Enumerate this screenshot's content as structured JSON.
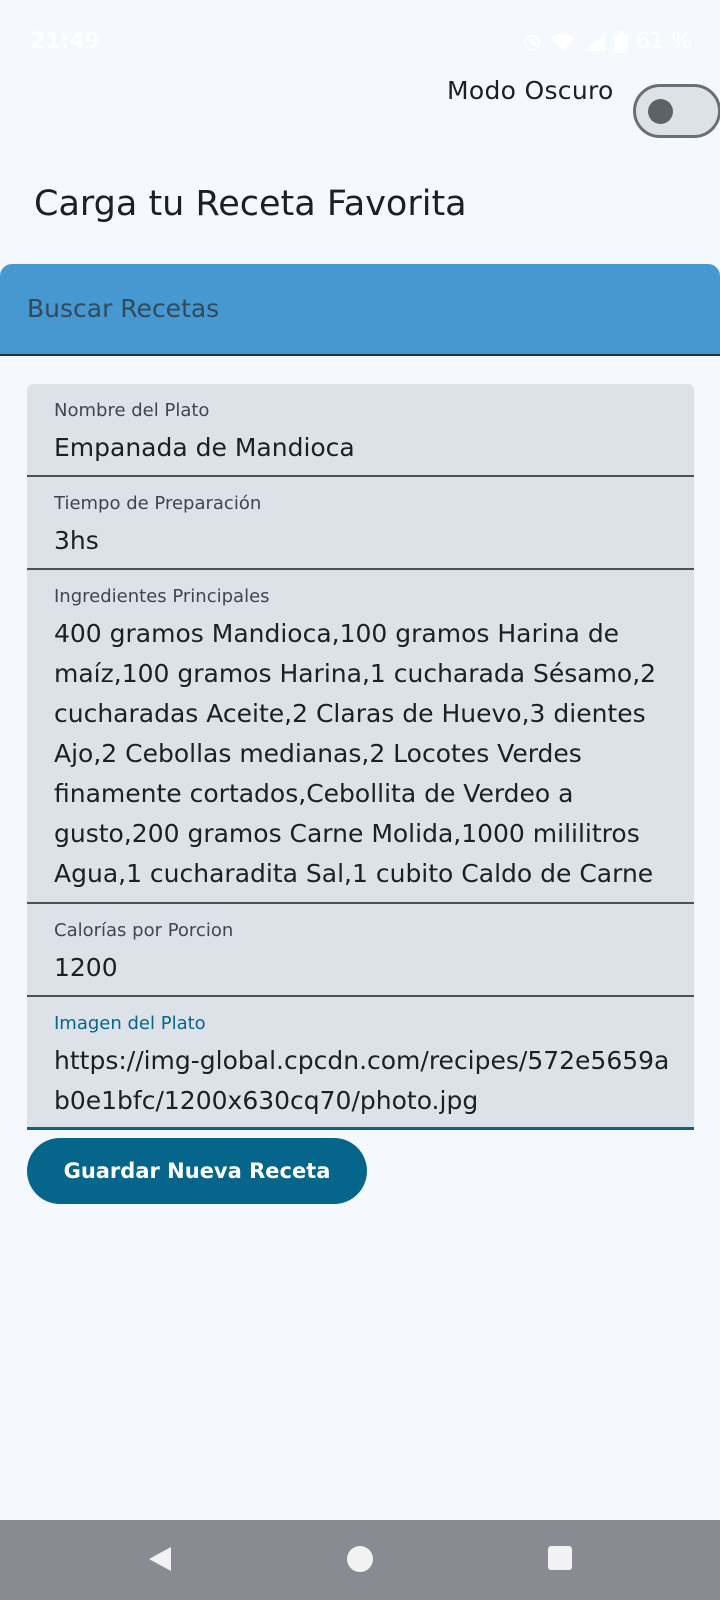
{
  "status_bar": {
    "time": "21:49",
    "battery": "61 %",
    "icons": [
      "alarm-icon",
      "wifi-icon",
      "signal-icon",
      "battery-icon"
    ]
  },
  "header": {
    "dark_mode_label": "Modo Oscuro",
    "dark_mode_on": false,
    "title": "Carga tu Receta Favorita"
  },
  "search": {
    "label": "Buscar Recetas"
  },
  "form": {
    "name": {
      "label": "Nombre del Plato",
      "value": "Empanada de Mandioca"
    },
    "prep_time": {
      "label": "Tiempo de Preparación",
      "value": "3hs"
    },
    "ingredients": {
      "label": "Ingredientes Principales",
      "value": "400 gramos Mandioca,100 gramos Harina de maíz,100 gramos Harina,1 cucharada Sésamo,2 cucharadas Aceite,2 Claras de Huevo,3 dientes Ajo,2 Cebollas medianas,2 Locotes Verdes finamente cortados,Cebollita de Verdeo a gusto,200 gramos Carne Molida,1000 mililitros Agua,1 cucharadita Sal,1 cubito Caldo de Carne"
    },
    "calories": {
      "label": "Calorías por Porcion",
      "value": "1200"
    },
    "image": {
      "label": "Imagen del Plato",
      "value": "https://img-global.cpcdn.com/recipes/572e5659ab0e1bfc/1200x630cq70/photo.jpg"
    },
    "save_label": "Guardar Nueva Receta"
  },
  "colors": {
    "accent": "#06658a",
    "search_bar": "#4698d0",
    "field_bg": "#dde2e9",
    "background": "#f5f8fc"
  }
}
